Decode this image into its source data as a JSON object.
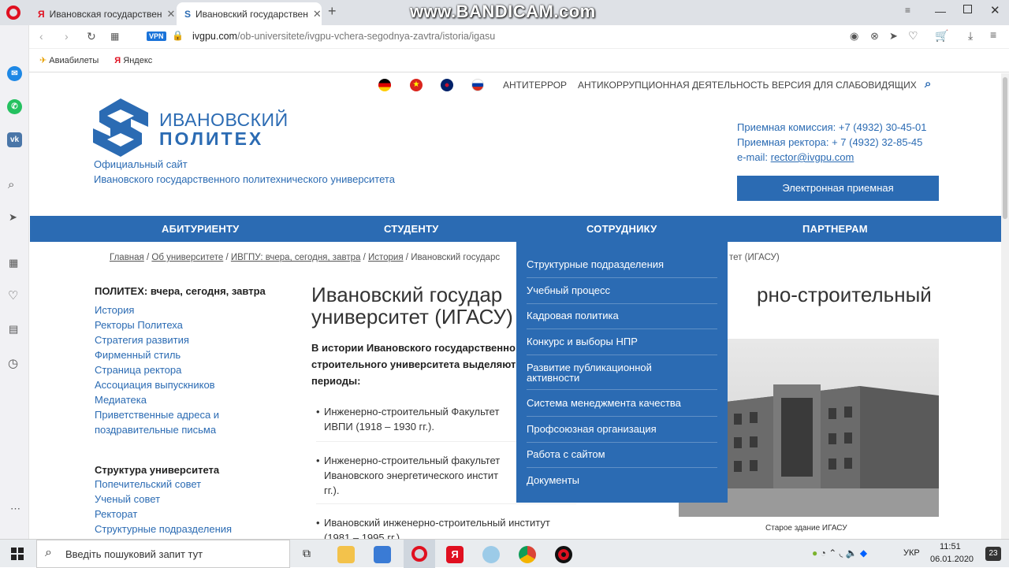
{
  "watermark": "www.BANDICAM.com",
  "browser": {
    "tabs": [
      {
        "title": "Ивановская государствен"
      },
      {
        "title": "Ивановский государствен"
      }
    ],
    "url_host": "ivgpu.com",
    "url_path": "/ob-universitete/ivgpu-vchera-segodnya-zavtra/istoria/igasu",
    "vpn_label": "VPN",
    "bookmarks": [
      "Авиабилеты",
      "Яндекс"
    ]
  },
  "site": {
    "top_links": [
      "АНТИТЕРРОР",
      "АНТИКОРРУПЦИОННАЯ ДЕЯТЕЛЬНОСТЬ",
      "ВЕРСИЯ ДЛЯ СЛАБОВИДЯЩИХ"
    ],
    "logo_line1": "ИВАНОВСКИЙ",
    "logo_line2": "ПОЛИТЕХ",
    "official_line1": "Официальный сайт",
    "official_line2": "Ивановского государственного политехнического университета",
    "contact_admission": "Приемная комиссия: +7 (4932) 30-45-01",
    "contact_rector": "Приемная ректора: + 7 (4932) 32-85-45",
    "email_label": "e-mail: ",
    "email": "rector@ivgpu.com",
    "reception_button": "Электронная приемная",
    "nav": [
      "АБИТУРИЕНТУ",
      "СТУДЕНТУ",
      "СОТРУДНИКУ",
      "ПАРТНЕРАМ"
    ],
    "breadcrumbs": [
      "Главная",
      "Об университете",
      "ИВГПУ: вчера, сегодня, завтра",
      "История"
    ],
    "breadcrumb_current_a": "Ивановский государс",
    "breadcrumb_current_b": "тет (ИГАСУ)",
    "sidebar_heading1": "ПОЛИТЕХ: вчера, сегодня, завтра",
    "sidebar_links1": [
      "История",
      "Ректоры Политеха",
      "Стратегия развития",
      "Фирменный стиль",
      "Страница ректора",
      "Ассоциация выпускников",
      "Медиатека",
      "Приветственные адреса и",
      "поздравительные письма"
    ],
    "sidebar_heading2": "Структура университета",
    "sidebar_links2": [
      "Попечительский совет",
      "Ученый совет",
      "Ректорат",
      "Структурные подразделения"
    ],
    "title_line1a": "Ивановский государ",
    "title_line1b": "рно-строительный",
    "title_line2": "университет (ИГАСУ)",
    "intro_line1": "В истории Ивановского государственно",
    "intro_line2": "строительного университета выделяют",
    "intro_line3": "периоды:",
    "bullets": [
      {
        "l1": "Инженерно-строительный Факультет",
        "l2": "ИВПИ (1918 – 1930 гг.)."
      },
      {
        "l1": "Инженерно-строительный факультет",
        "l2": "Ивановского энергетического инстит",
        "l3": "гг.)."
      },
      {
        "l1": "Ивановский инженерно-строительный институт",
        "l2": "(1981 – 1995 гг.)."
      }
    ],
    "photo_caption": "Старое здание ИГАСУ",
    "dropdown": [
      "Структурные подразделения",
      "Учебный процесс",
      "Кадровая политика",
      "Конкурс и выборы НПР",
      "Развитие публикационной",
      "активности",
      "Система менеджмента качества",
      "Профсоюзная организация",
      "Работа с сайтом",
      "Документы"
    ]
  },
  "taskbar": {
    "search_placeholder": "Введіть пошуковий запит тут",
    "lang": "УКР",
    "time": "11:51",
    "date": "06.01.2020",
    "notif_count": "23"
  },
  "colors": {
    "brand": "#2b6bb3",
    "nav": "#2b6bb3"
  }
}
